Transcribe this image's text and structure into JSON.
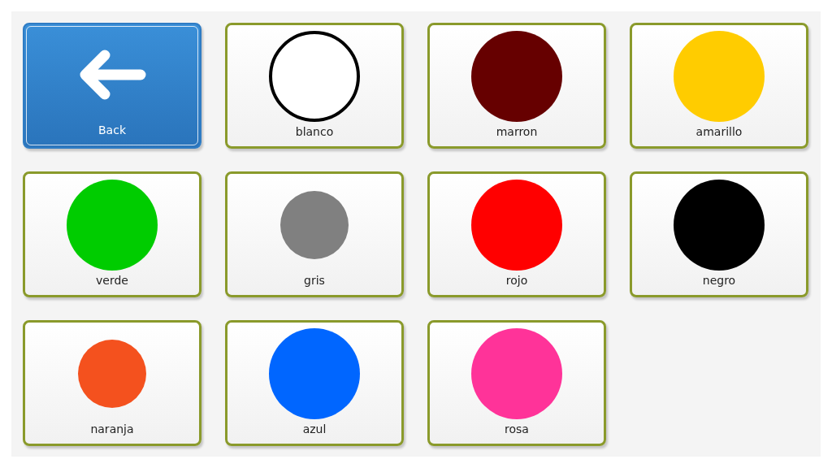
{
  "tiles": [
    {
      "kind": "back",
      "label": "Back"
    },
    {
      "kind": "swatch",
      "label": "blanco",
      "color": "#ffffff",
      "outlined": true
    },
    {
      "kind": "swatch",
      "label": "marron",
      "color": "#660000",
      "outlined": false
    },
    {
      "kind": "swatch",
      "label": "amarillo",
      "color": "#ffcc00",
      "outlined": false
    },
    {
      "kind": "swatch",
      "label": "verde",
      "color": "#00cc00",
      "outlined": false
    },
    {
      "kind": "smallswatch",
      "label": "gris",
      "color": "#808080",
      "outlined": false
    },
    {
      "kind": "swatch",
      "label": "rojo",
      "color": "#ff0000",
      "outlined": false
    },
    {
      "kind": "swatch",
      "label": "negro",
      "color": "#000000",
      "outlined": false
    },
    {
      "kind": "smallswatch",
      "label": "naranja",
      "color": "#f4511e",
      "outlined": false
    },
    {
      "kind": "swatch",
      "label": "azul",
      "color": "#0066ff",
      "outlined": false
    },
    {
      "kind": "swatch",
      "label": "rosa",
      "color": "#ff3399",
      "outlined": false
    }
  ]
}
